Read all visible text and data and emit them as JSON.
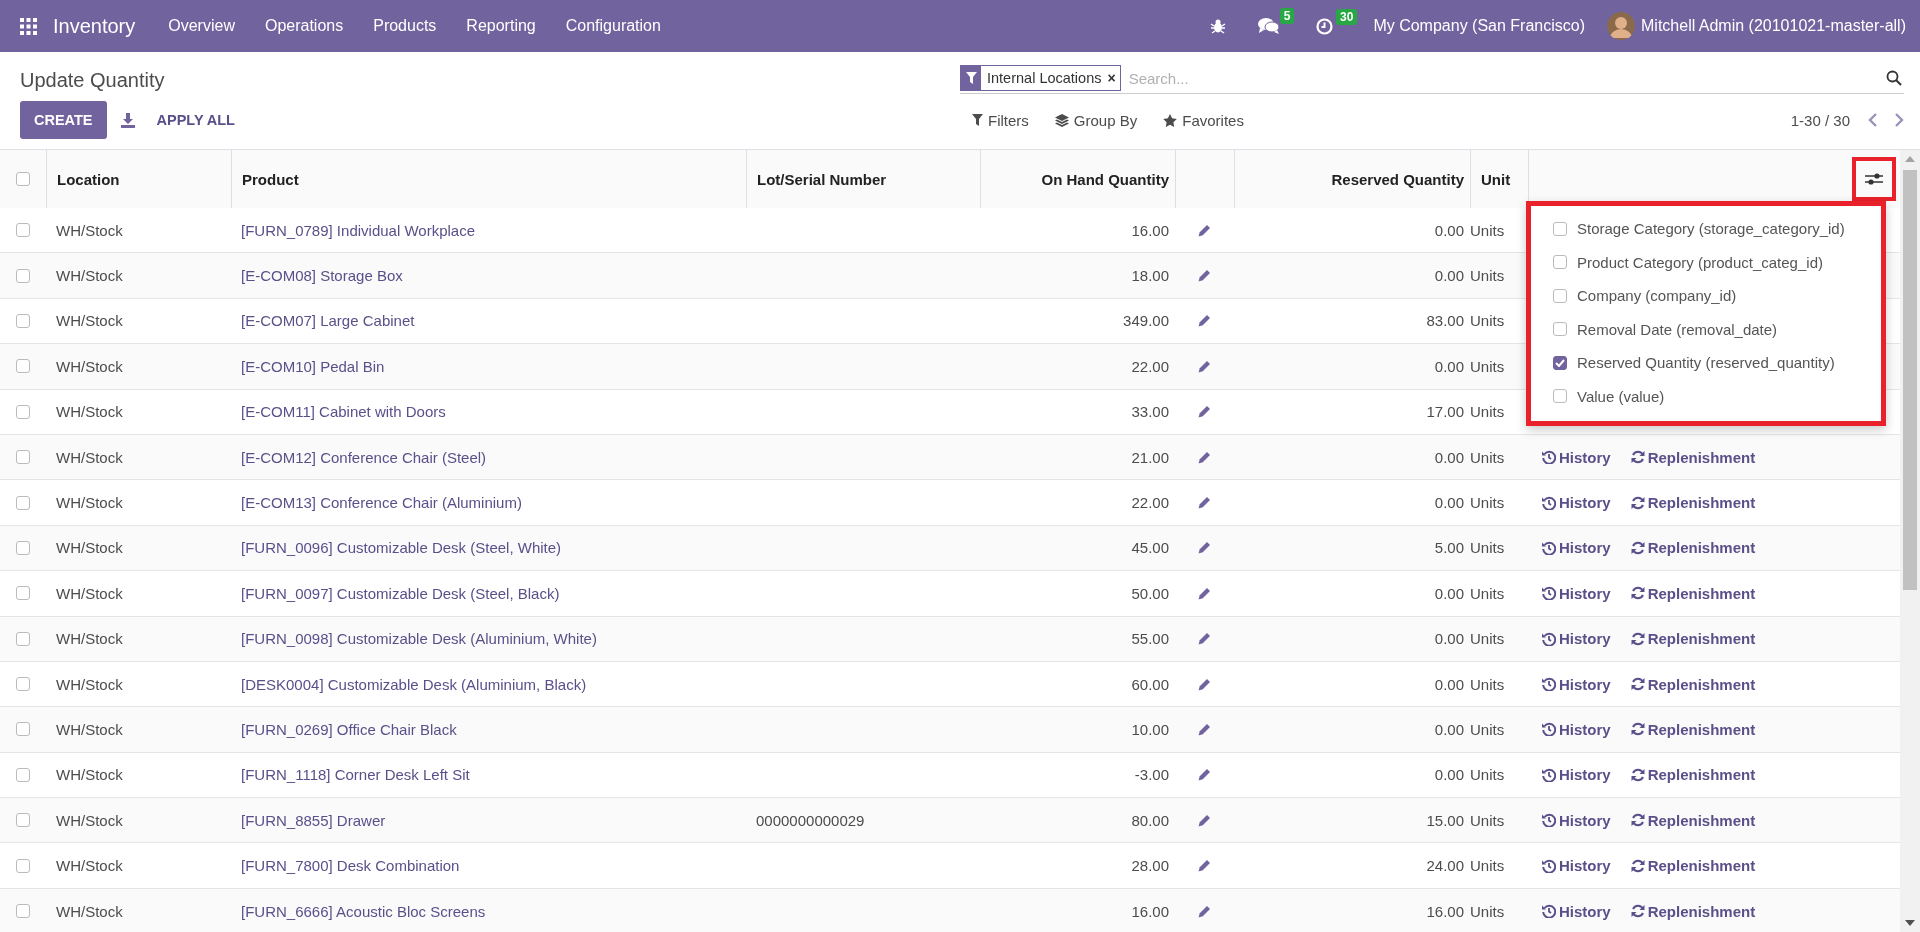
{
  "navbar": {
    "app_name": "Inventory",
    "menus": [
      "Overview",
      "Operations",
      "Products",
      "Reporting",
      "Configuration"
    ],
    "messages_count": "5",
    "activities_count": "30",
    "company": "My Company (San Francisco)",
    "user": "Mitchell Admin (20101021-master-all)"
  },
  "control_panel": {
    "breadcrumb": "Update Quantity",
    "create_button": "CREATE",
    "apply_all_button": "APPLY ALL",
    "search": {
      "facets": [
        {
          "label": "Internal Locations",
          "remove_icon": "×"
        }
      ],
      "placeholder": "Search..."
    },
    "filters": "Filters",
    "group_by": "Group By",
    "favorites": "Favorites",
    "pager": "1-30 / 30"
  },
  "table": {
    "all_selected": false,
    "columns": [
      "Location",
      "Product",
      "Lot/Serial Number",
      "On Hand Quantity",
      "Reserved Quantity",
      "Unit"
    ],
    "rows": [
      {
        "selected": false,
        "location": "WH/Stock",
        "product": "[FURN_0789] Individual Workplace",
        "on_hand": "16.00",
        "reserved": "0.00",
        "unit": "Units"
      },
      {
        "selected": false,
        "location": "WH/Stock",
        "product": "[E-COM08] Storage Box",
        "on_hand": "18.00",
        "reserved": "0.00",
        "unit": "Units"
      },
      {
        "selected": false,
        "location": "WH/Stock",
        "product": "[E-COM07] Large Cabinet",
        "on_hand": "349.00",
        "reserved": "83.00",
        "unit": "Units"
      },
      {
        "selected": false,
        "location": "WH/Stock",
        "product": "[E-COM10] Pedal Bin",
        "on_hand": "22.00",
        "reserved": "0.00",
        "unit": "Units"
      },
      {
        "selected": false,
        "location": "WH/Stock",
        "product": "[E-COM11] Cabinet with Doors",
        "on_hand": "33.00",
        "reserved": "17.00",
        "unit": "Units"
      },
      {
        "selected": false,
        "location": "WH/Stock",
        "product": "[E-COM12] Conference Chair (Steel)",
        "on_hand": "21.00",
        "reserved": "0.00",
        "unit": "Units",
        "actions": [
          "History",
          "Replenishment"
        ]
      },
      {
        "selected": false,
        "location": "WH/Stock",
        "product": "[E-COM13] Conference Chair (Aluminium)",
        "on_hand": "22.00",
        "reserved": "0.00",
        "unit": "Units",
        "actions": [
          "History",
          "Replenishment"
        ]
      },
      {
        "selected": false,
        "location": "WH/Stock",
        "product": "[FURN_0096] Customizable Desk (Steel, White)",
        "on_hand": "45.00",
        "reserved": "5.00",
        "unit": "Units",
        "actions": [
          "History",
          "Replenishment"
        ]
      },
      {
        "selected": false,
        "location": "WH/Stock",
        "product": "[FURN_0097] Customizable Desk (Steel, Black)",
        "on_hand": "50.00",
        "reserved": "0.00",
        "unit": "Units",
        "actions": [
          "History",
          "Replenishment"
        ]
      },
      {
        "selected": false,
        "location": "WH/Stock",
        "product": "[FURN_0098] Customizable Desk (Aluminium, White)",
        "on_hand": "55.00",
        "reserved": "0.00",
        "unit": "Units",
        "actions": [
          "History",
          "Replenishment"
        ]
      },
      {
        "selected": false,
        "location": "WH/Stock",
        "product": "[DESK0004] Customizable Desk (Aluminium, Black)",
        "on_hand": "60.00",
        "reserved": "0.00",
        "unit": "Units",
        "actions": [
          "History",
          "Replenishment"
        ]
      },
      {
        "selected": false,
        "location": "WH/Stock",
        "product": "[FURN_0269] Office Chair Black",
        "on_hand": "10.00",
        "reserved": "0.00",
        "unit": "Units",
        "actions": [
          "History",
          "Replenishment"
        ]
      },
      {
        "selected": false,
        "location": "WH/Stock",
        "product": "[FURN_1118] Corner Desk Left Sit",
        "on_hand": "-3.00",
        "reserved": "0.00",
        "unit": "Units",
        "actions": [
          "History",
          "Replenishment"
        ]
      },
      {
        "selected": false,
        "location": "WH/Stock",
        "product": "[FURN_8855] Drawer",
        "lot": "0000000000029",
        "on_hand": "80.00",
        "reserved": "15.00",
        "unit": "Units",
        "actions": [
          "History",
          "Replenishment"
        ]
      },
      {
        "selected": false,
        "location": "WH/Stock",
        "product": "[FURN_7800] Desk Combination",
        "on_hand": "28.00",
        "reserved": "24.00",
        "unit": "Units",
        "actions": [
          "History",
          "Replenishment"
        ]
      },
      {
        "selected": false,
        "location": "WH/Stock",
        "product": "[FURN_6666] Acoustic Bloc Screens",
        "on_hand": "16.00",
        "reserved": "16.00",
        "unit": "Units",
        "actions": [
          "History",
          "Replenishment"
        ]
      }
    ]
  },
  "optional_columns": [
    {
      "label": "Storage Category (storage_category_id)",
      "checked": false
    },
    {
      "label": "Product Category (product_categ_id)",
      "checked": false
    },
    {
      "label": "Company (company_id)",
      "checked": false
    },
    {
      "label": "Removal Date (removal_date)",
      "checked": false
    },
    {
      "label": "Reserved Quantity (reserved_quantity)",
      "checked": true
    },
    {
      "label": "Value (value)",
      "checked": false
    }
  ]
}
